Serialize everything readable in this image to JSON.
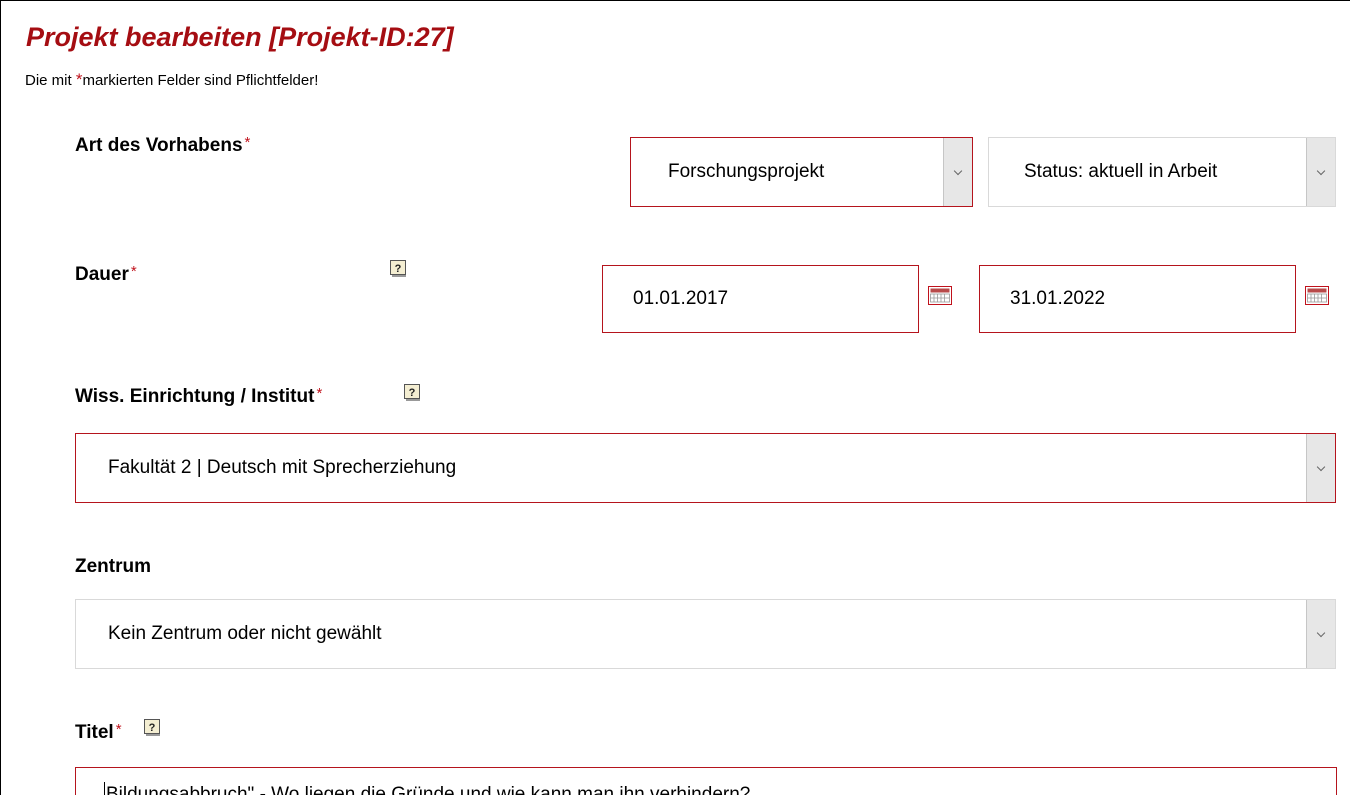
{
  "header": {
    "title": "Projekt bearbeiten [Projekt-ID:27]",
    "note_prefix": "Die mit ",
    "note_star": "*",
    "note_suffix": "markierten Felder sind Pflichtfelder!"
  },
  "form": {
    "required_star": "*",
    "art": {
      "label": "Art des Vorhabens",
      "type_value": "Forschungsprojekt",
      "status_value": "Status: aktuell in Arbeit"
    },
    "dauer": {
      "label": "Dauer",
      "start": "01.01.2017",
      "end": "31.01.2022"
    },
    "einrichtung": {
      "label": "Wiss. Einrichtung / Institut",
      "value": "Fakultät 2 | Deutsch mit Sprecherziehung"
    },
    "zentrum": {
      "label": "Zentrum",
      "value": "Kein Zentrum oder nicht gewählt"
    },
    "titel": {
      "label": "Titel",
      "value": "Bildungsabbruch\" - Wo liegen die Gründe und wie kann man ihn verhindern?"
    }
  },
  "icons": {
    "help": "help-question-icon",
    "calendar": "calendar-icon",
    "dropdown": "chevron-down-icon"
  },
  "colors": {
    "title": "#a50d12",
    "required_border": "#b5141d",
    "required_star": "#c0121c",
    "arrow_bg": "#e7e7e7"
  }
}
